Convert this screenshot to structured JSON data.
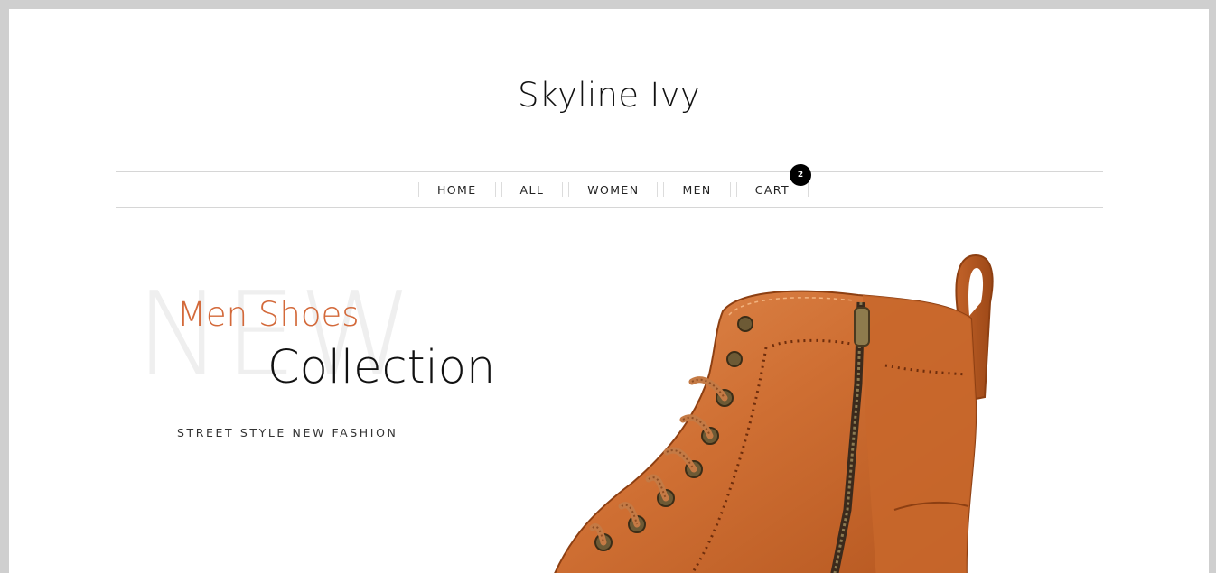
{
  "site": {
    "title": "Skyline Ivy"
  },
  "nav": {
    "items": [
      {
        "label": "HOME"
      },
      {
        "label": "ALL"
      },
      {
        "label": "WOMEN"
      },
      {
        "label": "MEN"
      },
      {
        "label": "CART"
      }
    ],
    "cart_count": "2"
  },
  "hero": {
    "background_word": "NEW",
    "subtitle": "Men Shoes",
    "title": "Collection",
    "tagline": "STREET STYLE NEW FASHION",
    "image_icon": "leather-boot-image",
    "accent_color": "#d3693a"
  }
}
